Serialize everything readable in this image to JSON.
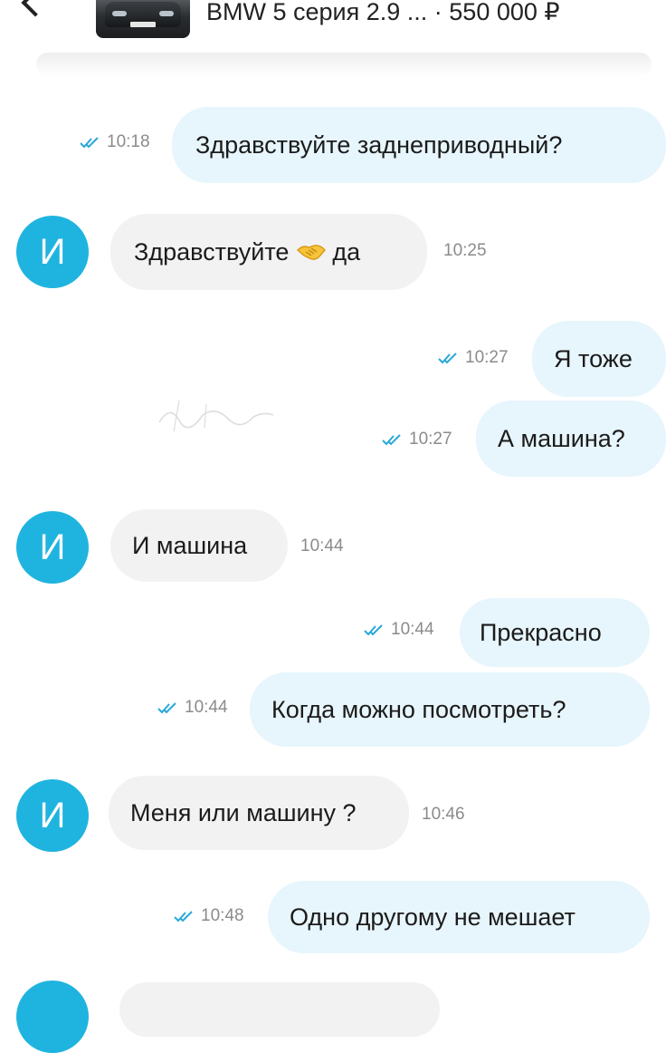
{
  "header": {
    "listing_title": "BMW 5 серия 2.9 ...",
    "listing_price": "· 550 000 ₽",
    "thumbnail_icon": "car-photo"
  },
  "colors": {
    "outgoing_bubble": "#e7f5fc",
    "incoming_bubble": "#f2f2f2",
    "avatar": "#1fb4df",
    "read_ticks": "#29a8d8"
  },
  "messages": [
    {
      "direction": "out",
      "text": "Здравствуйте заднеприводный?",
      "time": "10:18",
      "status": "read"
    },
    {
      "direction": "in",
      "avatar": "И",
      "text": "Здравствуйте",
      "emoji": "handshake",
      "text_after": "да",
      "time": "10:25"
    },
    {
      "direction": "out",
      "text": "Я тоже",
      "time": "10:27",
      "status": "read"
    },
    {
      "direction": "out",
      "text": "А машина?",
      "time": "10:27",
      "status": "read"
    },
    {
      "direction": "in",
      "avatar": "И",
      "text": "И машина",
      "time": "10:44"
    },
    {
      "direction": "out",
      "text": "Прекрасно",
      "time": "10:44",
      "status": "read"
    },
    {
      "direction": "out",
      "text": "Когда можно посмотреть?",
      "time": "10:44",
      "status": "read"
    },
    {
      "direction": "in",
      "avatar": "И",
      "text": "Меня или машину ?",
      "time": "10:46"
    },
    {
      "direction": "out",
      "text": "Одно другому не мешает",
      "time": "10:48",
      "status": "read"
    }
  ]
}
